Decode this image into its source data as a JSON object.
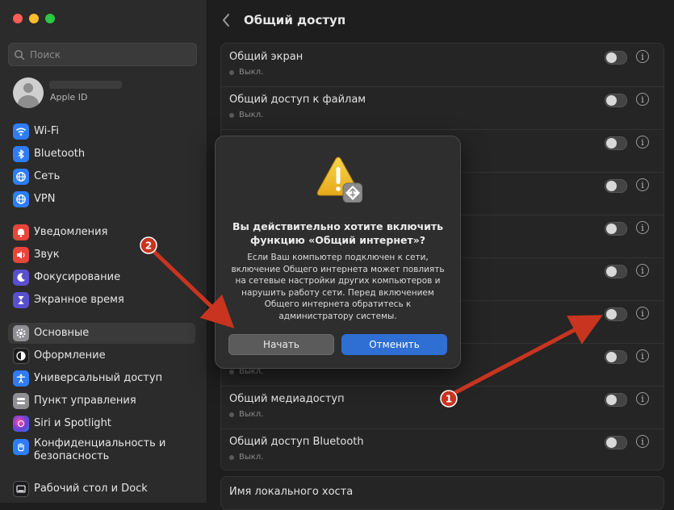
{
  "sidebar": {
    "search_placeholder": "Поиск",
    "account_subtitle": "Apple ID",
    "items": [
      {
        "label": "Wi-Fi",
        "color": "#2f7cf6",
        "icon": "wifi-icon"
      },
      {
        "label": "Bluetooth",
        "color": "#2f7cf6",
        "icon": "bluetooth-icon"
      },
      {
        "label": "Сеть",
        "color": "#2f7cf6",
        "icon": "globe-icon"
      },
      {
        "label": "VPN",
        "color": "#2f7cf6",
        "icon": "vpn-icon"
      },
      {
        "label": "Уведомления",
        "color": "#e8453c",
        "icon": "bell-icon"
      },
      {
        "label": "Звук",
        "color": "#e8453c",
        "icon": "speaker-icon"
      },
      {
        "label": "Фокусирование",
        "color": "#5a4fcf",
        "icon": "moon-icon"
      },
      {
        "label": "Экранное время",
        "color": "#5a4fcf",
        "icon": "hourglass-icon"
      },
      {
        "label": "Основные",
        "color": "#8e8e93",
        "icon": "gear-icon"
      },
      {
        "label": "Оформление",
        "color": "#1c1c1e",
        "icon": "appearance-icon"
      },
      {
        "label": "Универсальный доступ",
        "color": "#2f7cf6",
        "icon": "accessibility-icon"
      },
      {
        "label": "Пункт управления",
        "color": "#8e8e93",
        "icon": "control-center-icon"
      },
      {
        "label": "Siri и Spotlight",
        "color": "#6b3fd6",
        "icon": "siri-icon"
      },
      {
        "label": "Конфиденциальность и безопасность",
        "color": "#2f7cf6",
        "icon": "hand-icon"
      },
      {
        "label": "Рабочий стол и Dock",
        "color": "#1c1c1e",
        "icon": "dock-icon"
      }
    ]
  },
  "main": {
    "title": "Общий доступ",
    "rows": [
      {
        "name": "Общий экран",
        "status": "Выкл."
      },
      {
        "name": "Общий доступ к файлам",
        "status": "Выкл."
      },
      {
        "name": "",
        "status": ""
      },
      {
        "name": "",
        "status": ""
      },
      {
        "name": "",
        "status": ""
      },
      {
        "name": "",
        "status": ""
      },
      {
        "name": "",
        "status": ""
      },
      {
        "name": "",
        "status": "Выкл."
      },
      {
        "name": "Общий медиадоступ",
        "status": "Выкл."
      },
      {
        "name": "Общий доступ Bluetooth",
        "status": "Выкл."
      }
    ],
    "hostname_label": "Имя локального хоста"
  },
  "dialog": {
    "heading": "Вы действительно хотите включить функцию «Общий интернет»?",
    "body": "Если Ваш компьютер подключен к сети, включение Общего интернета может повлиять на сетевые настройки других компьютеров и нарушить работу сети. Перед включением Общего интернета обратитесь к администратору системы.",
    "start_label": "Начать",
    "cancel_label": "Отменить"
  },
  "annotations": {
    "marker_1": "1",
    "marker_2": "2",
    "arrow_color": "#c8341f"
  }
}
